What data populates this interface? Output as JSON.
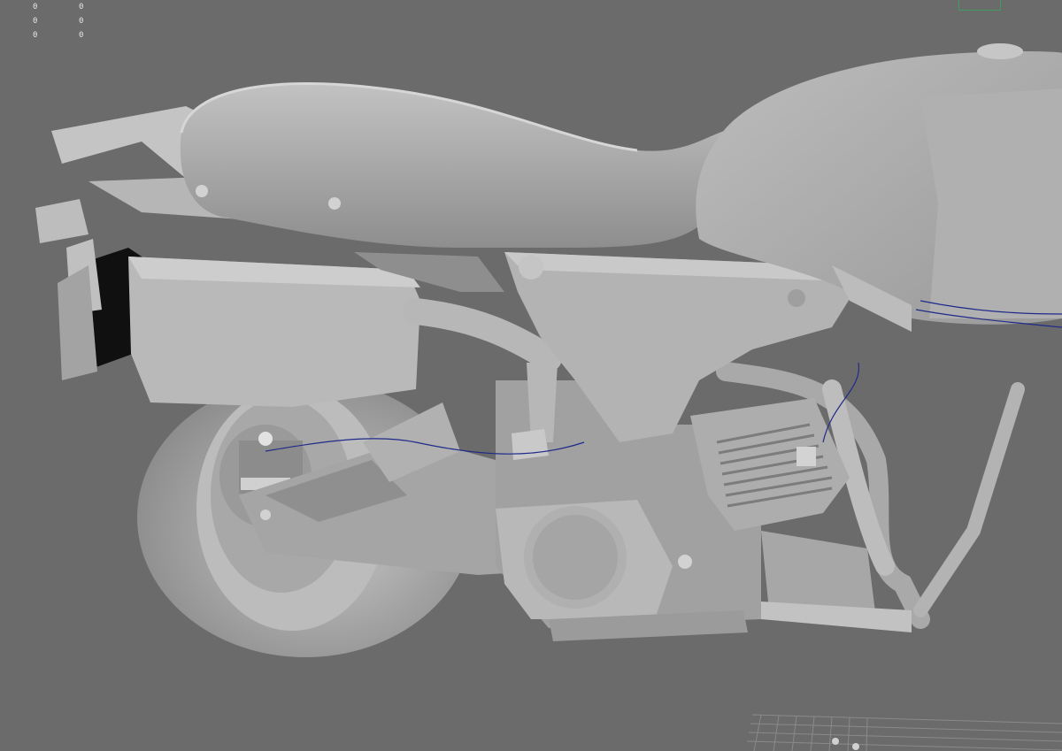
{
  "hud": {
    "stats": [
      {
        "left": "0",
        "right": "0"
      },
      {
        "left": "0",
        "right": "0"
      },
      {
        "left": "0",
        "right": "0"
      }
    ]
  },
  "colors": {
    "background": "#6b6b6b",
    "model_light": "#b2b2b2",
    "model_mid": "#9a9a9a",
    "model_dark": "#7e7e7e",
    "shadow": "#111111",
    "wire": "#1f2a8a",
    "viewcube_outline": "#3e9c63"
  },
  "viewport": {
    "shading": "smooth-shaded",
    "subject": "motorcycle-model",
    "grid": true
  }
}
